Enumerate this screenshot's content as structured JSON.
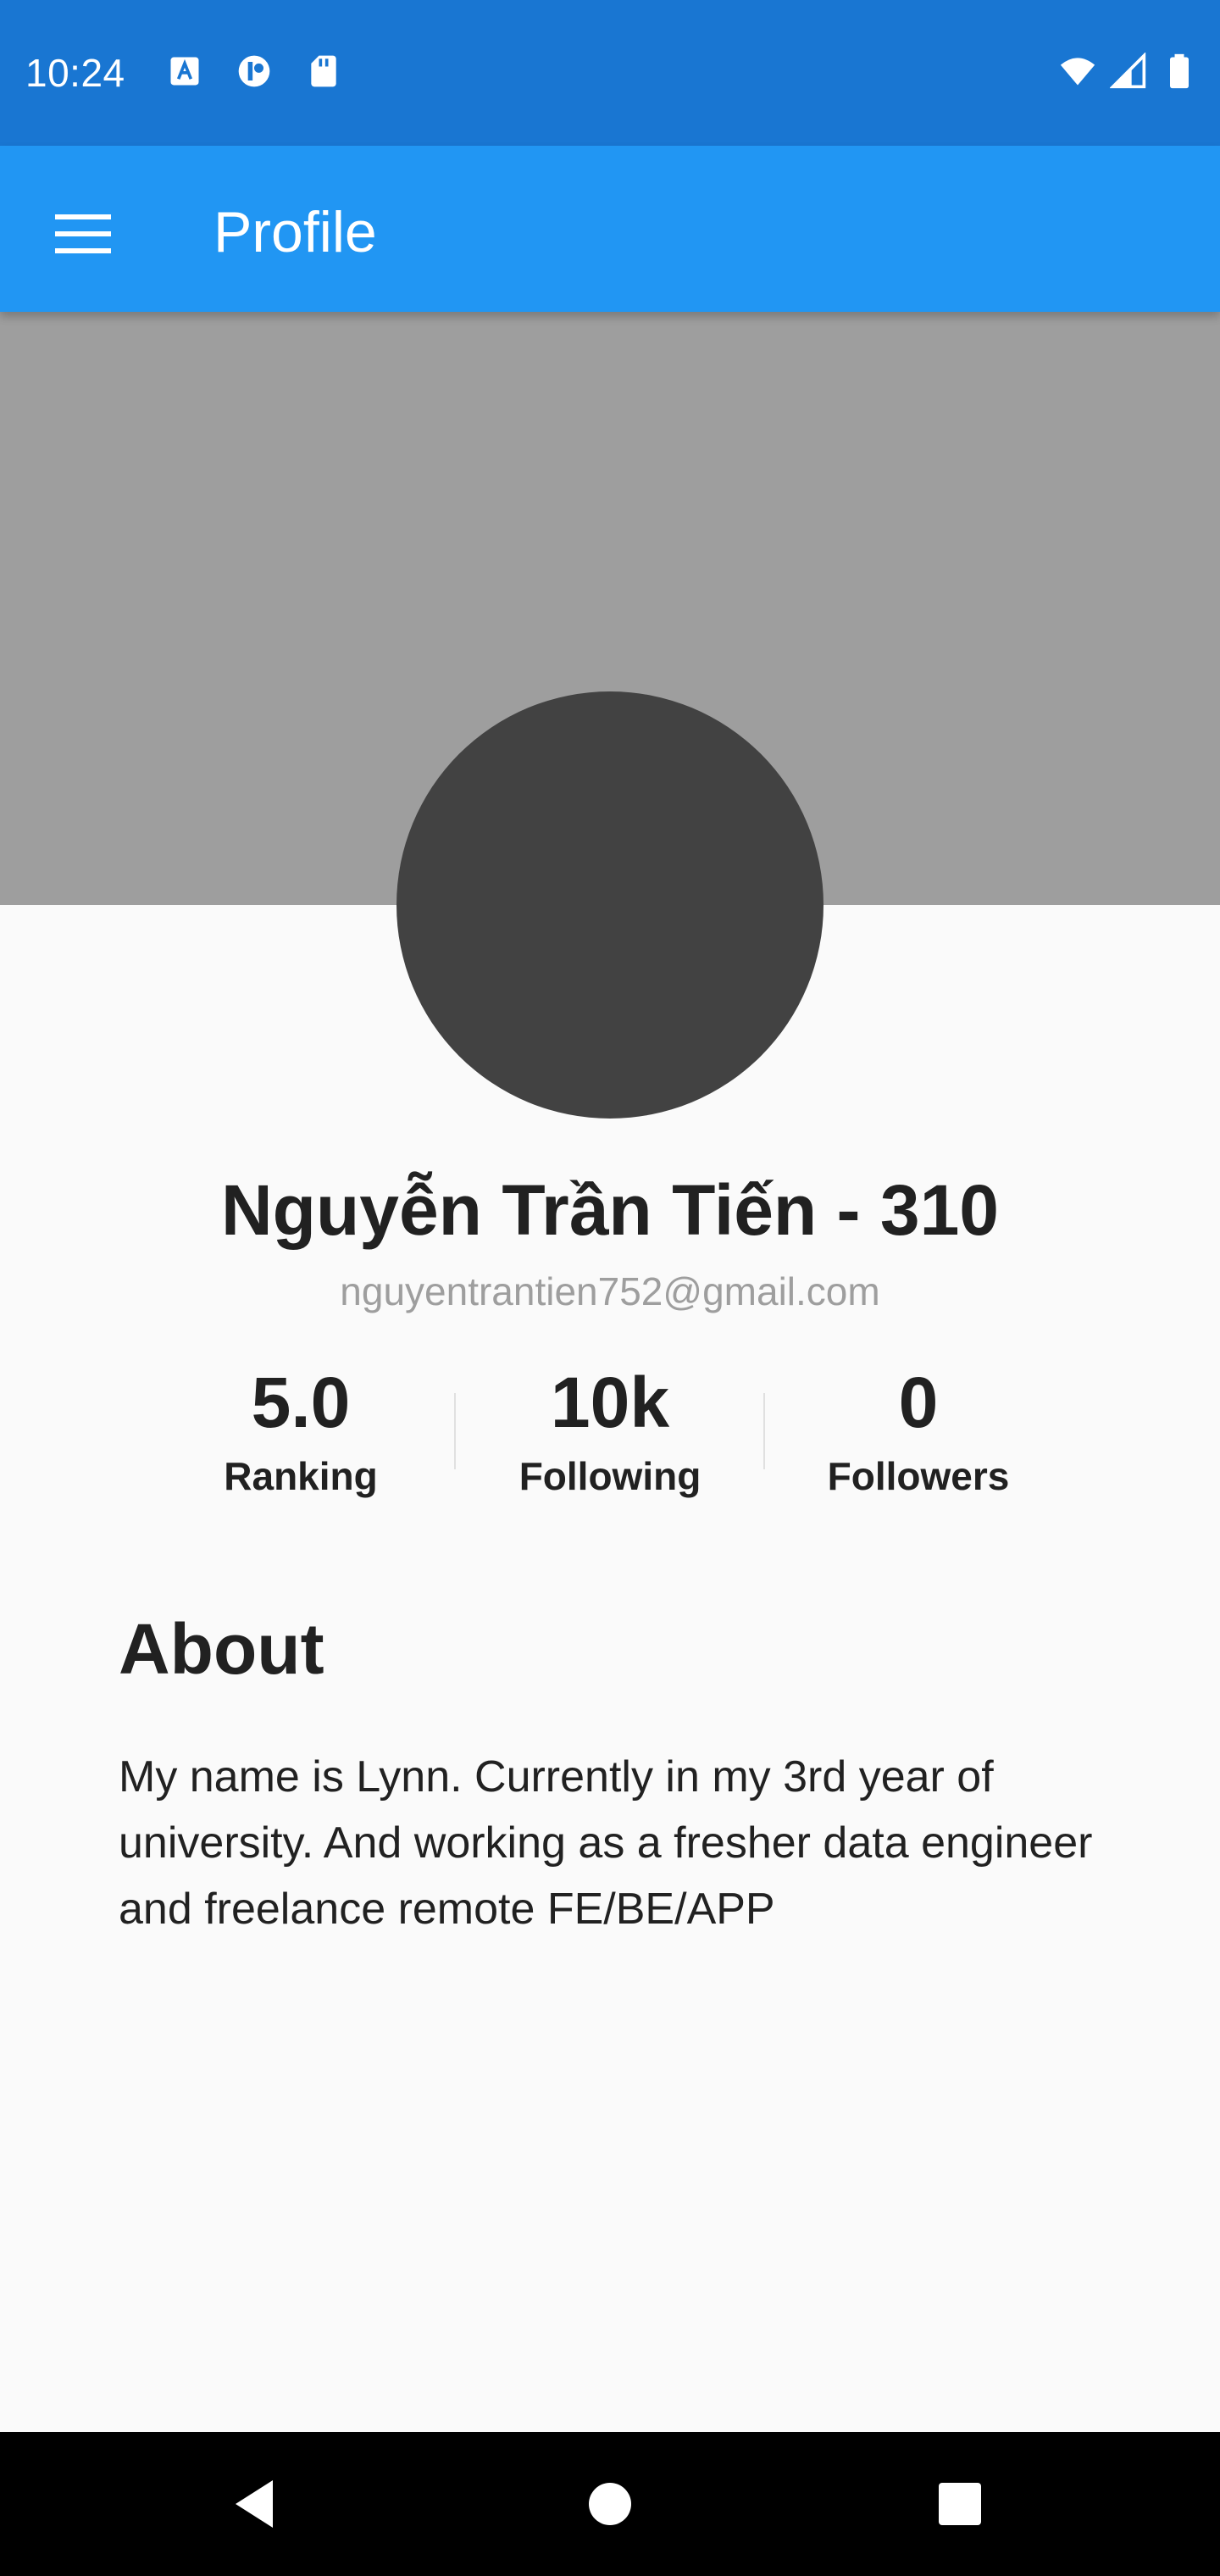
{
  "status_bar": {
    "time": "10:24",
    "left_icons": [
      "a-box-icon",
      "notification-circle-icon",
      "sd-card-icon"
    ],
    "right_icons": [
      "wifi-icon",
      "cell-signal-icon",
      "battery-icon"
    ]
  },
  "app_bar": {
    "title": "Profile",
    "menu_icon": "hamburger-menu-icon",
    "background": "#2196f3"
  },
  "profile": {
    "name": "Nguyễn Trần Tiến - 310",
    "email": "nguyentrantien752@gmail.com"
  },
  "stats": [
    {
      "value": "5.0",
      "label": "Ranking"
    },
    {
      "value": "10k",
      "label": "Following"
    },
    {
      "value": "0",
      "label": "Followers"
    }
  ],
  "about": {
    "heading": "About",
    "text": "My name is Lynn. Currently in my 3rd year of university. And working as a fresher data engineer and freelance remote FE/BE/APP"
  },
  "nav_bar": {
    "buttons": [
      "back-icon",
      "home-icon",
      "recents-icon"
    ]
  },
  "colors": {
    "status_bar": "#1976d2",
    "app_bar": "#2196f3",
    "cover": "#9e9e9e",
    "avatar": "#424242"
  }
}
